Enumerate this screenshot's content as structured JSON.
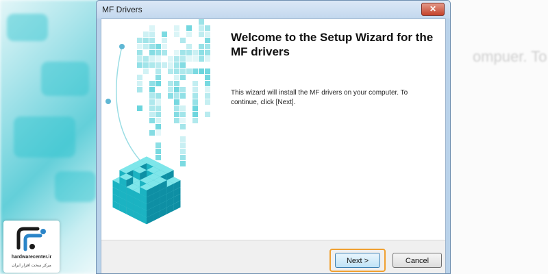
{
  "window": {
    "title": "MF Drivers",
    "close_glyph": "✕"
  },
  "wizard": {
    "heading": "Welcome to the Setup Wizard for the MF drivers",
    "body": "This wizard will install the MF drivers on your computer. To continue, click [Next].",
    "graphic_icon": "teal-cube-pixel-graphic"
  },
  "buttons": {
    "next_label": "Next >",
    "cancel_label": "Cancel"
  },
  "watermark": {
    "site": "hardwarecenter.ir",
    "tagline": "مرکز سخت افزار ایران"
  },
  "background": {
    "faded_text": "ompuer. To"
  },
  "colors": {
    "accent_teal": "#2cc3cf",
    "focus_orange": "#f0a030",
    "titlebar": "#c3d8ee"
  }
}
